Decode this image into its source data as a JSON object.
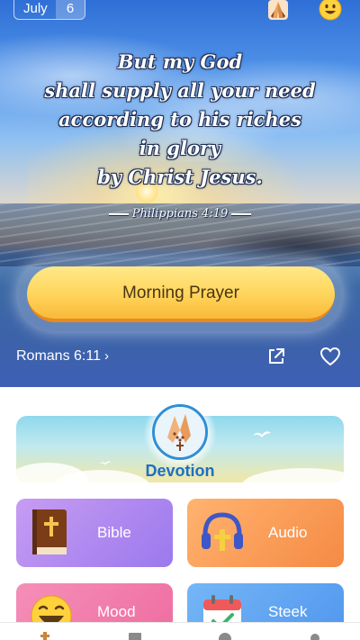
{
  "header": {
    "month": "July",
    "day": "6"
  },
  "verse": {
    "lines": [
      "But my God",
      "shall supply all your need",
      "according to his riches",
      "in glory",
      "by Christ Jesus."
    ],
    "reference": "Philippians 4:19"
  },
  "primary_action": {
    "label": "Morning Prayer"
  },
  "hero_footer": {
    "link_label": "Romans 6:11",
    "chevron": "›"
  },
  "cards": {
    "devotion": "Devotion",
    "bible": "Bible",
    "audio": "Audio",
    "mood": "Mood",
    "steek": "Steek"
  },
  "icons": {
    "top": [
      "praying-hands-icon",
      "smiley-icon"
    ],
    "hero": [
      "share-icon",
      "heart-icon"
    ],
    "cards": [
      "praying-hands-rosary-icon",
      "bible-book-icon",
      "headphones-icon",
      "laughing-emoji-icon",
      "calendar-check-icon"
    ],
    "nav": [
      "cross-icon",
      "book-icon",
      "question-icon",
      "profile-icon"
    ]
  },
  "colors": {
    "button_gold": "#ffd45a",
    "devotion_blue": "#1e6fbf",
    "bible_purple": "#9b79ee",
    "audio_orange": "#f58a45",
    "mood_pink": "#ee6b9f",
    "steek_blue": "#4f95ee"
  }
}
